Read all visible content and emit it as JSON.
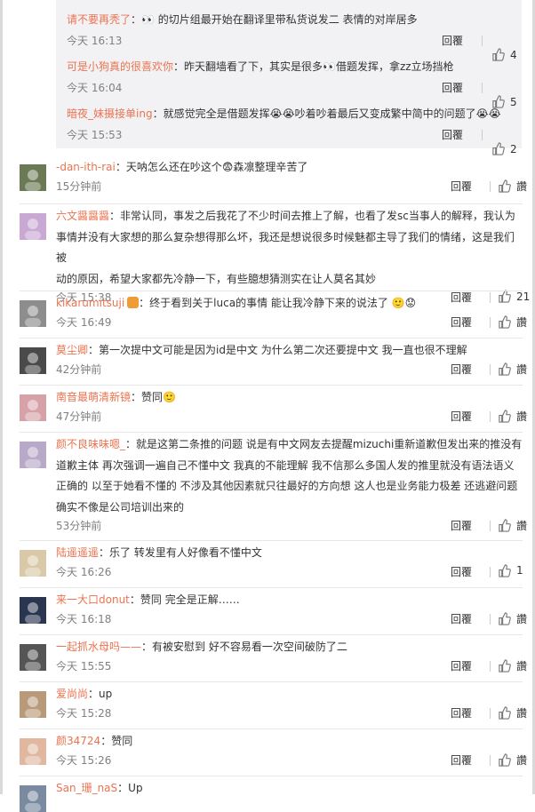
{
  "nested_replies": [
    {
      "user": "请不要再秃了",
      "text": "：👀 的切片组最开始在翻译里带私货说发⼆ 表情的对岸居多",
      "time": "今天 16:13",
      "reply": "回覆",
      "likes": "4"
    },
    {
      "user": "可是小狗真的很喜欢你",
      "text": "：昨天翻墙看了下，其实是很多👀借题发挥，拿zz立场挡枪",
      "time": "今天 16:04",
      "reply": "回覆",
      "likes": "5"
    },
    {
      "user": "暗夜_妹摄接单ing",
      "text": "：就感觉完全是借题发挥😭😭吵着吵着最后又变成繁中简中的问题了😭😭",
      "time": "今天 15:53",
      "reply": "回覆",
      "likes": "2"
    }
  ],
  "comments": [
    {
      "user": "-dan-ith-rai",
      "text_lines": [
        "：天呐怎么还在吵这个😨森凛整理辛苦了"
      ],
      "time": "15分钟前",
      "reply": "回覆",
      "likes": "讚",
      "avatar_color": "#6b7a55"
    },
    {
      "user": "六文醤醤醤",
      "text_lines": [
        "：非常认同，事发之后我花了不少时间去推上了解，也看了发sc当事人的解释，我认为",
        "事情并没有大家想的那么复杂想得那么坏，我还是想说很多时候魅都主导了我们的情绪，这是我们被",
        "动的原因，希望大家都先冷静一下，有些臆想猜测实在让人莫名其妙"
      ],
      "time": "今天 15:38",
      "reply": "回覆",
      "likes": "21",
      "avatar_color": "#c9a8d4"
    },
    {
      "user": "kikarumitsuji",
      "text_lines": [
        "：终于看到关于luca的事情 能让我冷静下来的说法了 🙂😟"
      ],
      "time": "今天 16:49",
      "reply": "回覆",
      "likes": "讚",
      "avatar_color": "#8d8d8d",
      "badge": true
    },
    {
      "user": "莫尘卿",
      "text_lines": [
        "：第一次提中文可能是因为id是中文 为什么第二次还要提中文 我一直也很不理解"
      ],
      "time": "42分钟前",
      "reply": "回覆",
      "likes": "讚",
      "avatar_color": "#4a4a4a"
    },
    {
      "user": "南音最萌清新镜",
      "text_lines": [
        "：赞同🙂"
      ],
      "time": "47分钟前",
      "reply": "回覆",
      "likes": "讚",
      "avatar_color": "#d6a2a8"
    },
    {
      "user": "颜不良味味嗯_",
      "text_lines": [
        "：就是这第二条推的问题 说是有中文网友去提醒mizuchi重新道歉但发出来的推没有",
        "道歉主体 再次强调一遍自己不懂中文 我真的不能理解 我不信那么多国人发的推里就没有语法语义",
        "正确的 以至于她看不懂的 不涉及其他因素就只往最好的方向想 这人也是业务能力极差 还逃避问题",
        "确实不像是公司培训出来的"
      ],
      "time": "53分钟前",
      "reply": "回覆",
      "likes": "讚",
      "avatar_color": "#b8a9c9"
    },
    {
      "user": "陆遥遥遥",
      "text_lines": [
        "：乐了 转发里有人好像看不懂中文"
      ],
      "time": "今天 16:26",
      "reply": "回覆",
      "likes": "1",
      "avatar_color": "#d9c9a8"
    },
    {
      "user": "来一大口donut",
      "text_lines": [
        "：赞同 完全是正解……"
      ],
      "time": "今天 16:18",
      "reply": "回覆",
      "likes": "讚",
      "avatar_color": "#2a3650"
    },
    {
      "user": "一起抓水母吗——",
      "text_lines": [
        "：有被安慰到 好不容易看一次空间破防了⼆"
      ],
      "time": "今天 15:55",
      "reply": "回覆",
      "likes": "讚",
      "avatar_color": "#555555"
    },
    {
      "user": "爱尚尚",
      "text_lines": [
        "：up"
      ],
      "time": "今天 15:28",
      "reply": "回覆",
      "likes": "讚",
      "avatar_color": "#b89a7a"
    },
    {
      "user": "颜34724",
      "text_lines": [
        "：赞同"
      ],
      "time": "今天 15:26",
      "reply": "回覆",
      "likes": "讚",
      "avatar_color": "#e0b8a0"
    },
    {
      "user": "San_珊_naS",
      "text_lines": [
        "：Up"
      ],
      "time": "",
      "reply": "",
      "likes": "",
      "avatar_color": "#7a8aa0"
    }
  ]
}
